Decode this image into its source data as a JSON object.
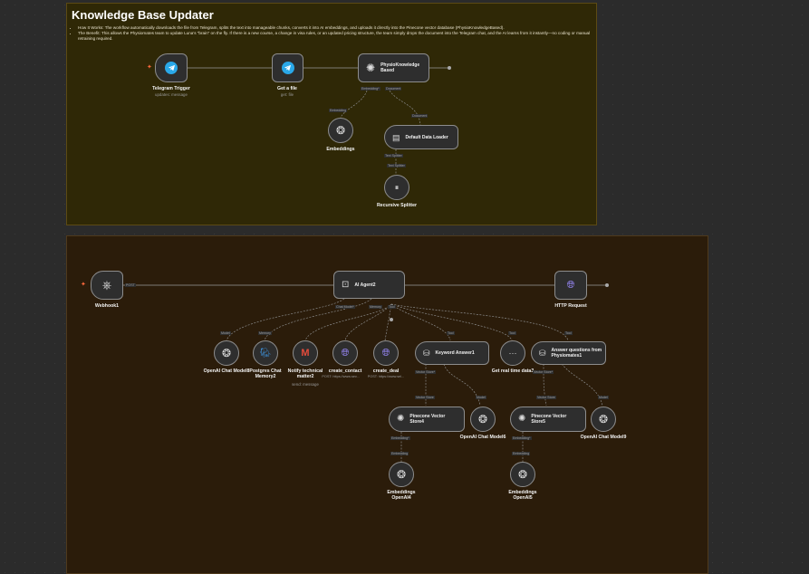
{
  "sticky_top": {
    "title": "Knowledge Base Updater",
    "bullet1": "How It Works: The workflow automatically downloads the file from Telegram, splits the text into manageable chunks, converts it into AI embeddings, and uploads it directly into the Pinecone vector database (PhysioKnowledgeBased).",
    "bullet2": "The Benefit: This allows the Physiomates team to update Luna's \"brain\" on the fly. If there is a new course, a change in visa rules, or an updated pricing structure, the team simply drops the document into the Telegram chat, and the AI learns from it instantly—no coding or manual retraining required."
  },
  "top_flow": {
    "telegram_trigger": {
      "label": "Telegram Trigger",
      "sub": "updates: message"
    },
    "get_file": {
      "label": "Get a file",
      "sub": "get: file"
    },
    "physio_store": {
      "label": "PhysioKnowledgeBased"
    },
    "embeddings": {
      "label": "Embeddings"
    },
    "data_loader": {
      "label": "Default Data Loader"
    },
    "splitter": {
      "label": "Recursive Splitter"
    },
    "ports": {
      "embedding": "Embedding",
      "embedding_star": "Embedding*",
      "document": "Document",
      "text_splitter": "Text Splitter"
    }
  },
  "bottom_flow": {
    "webhook": {
      "label": "Webhook1",
      "port": "POST"
    },
    "ai_agent": {
      "label": "AI Agent2"
    },
    "http_request": {
      "label": "HTTP Request"
    },
    "agent_ports": {
      "chat_model": "Chat Model*",
      "memory": "Memory",
      "tool": "Tool"
    },
    "tools": [
      {
        "label": "OpenAI Chat Model8",
        "port": "Model"
      },
      {
        "label": "Postgres Chat Memory2",
        "port": "Memory"
      },
      {
        "label": "Notify technical matter2",
        "sub": "send: message",
        "port": "Tool"
      },
      {
        "label": "create_contact",
        "sub": "POST: https://www.sev...",
        "port": "Tool"
      },
      {
        "label": "create_deal",
        "sub": "POST: https://www.sel...",
        "port": "Tool"
      },
      {
        "label": "Keyword Answer1",
        "port": "Tool"
      },
      {
        "label": "Get real time data3",
        "port": "Tool"
      },
      {
        "label": "Answer questions from Physiomates1",
        "port": "Tool"
      }
    ],
    "vector_port": "Vector Store*",
    "store4": {
      "label": "Pinecone Vector Store4"
    },
    "store5": {
      "label": "Pinecone Vector Store5"
    },
    "model6": {
      "label": "OpenAI Chat Model6"
    },
    "model9": {
      "label": "OpenAI Chat Model9"
    },
    "emb4": {
      "label": "Embeddings OpenAI4"
    },
    "emb5": {
      "label": "Embeddings OpenAI5"
    },
    "ports": {
      "vector_store": "Vector Store",
      "model": "Model",
      "embedding_star": "Embedding*",
      "embedding": "Embedding"
    }
  },
  "colors": {
    "top_note": "#2f2806",
    "bottom_note": "#2b1c0a",
    "telegram": "#2aa8e8",
    "http": "#9c8bff",
    "trigger_bolt": "#ff6a3d"
  },
  "icons": {
    "telegram": "telegram-icon",
    "pinecone": "pinecone-icon",
    "openai": "openai-icon",
    "webhook": "webhook-icon",
    "agent": "robot-icon",
    "globe": "globe-icon",
    "gmail": "gmail-icon",
    "postgres": "postgres-icon",
    "database": "database-icon",
    "doc": "document-icon"
  }
}
